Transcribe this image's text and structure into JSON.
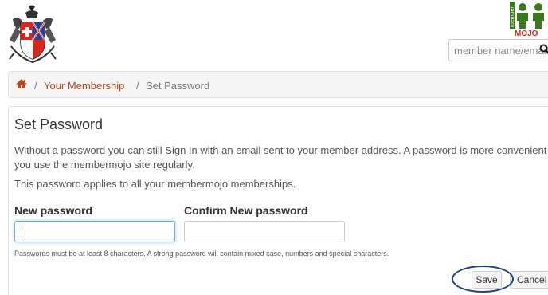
{
  "header": {
    "search": {
      "placeholder": "member name/email"
    },
    "logo_text": "member",
    "logo_brand": "MOJO"
  },
  "breadcrumb": {
    "separator": "/",
    "link": "Your Membership",
    "current": "Set Password"
  },
  "panel": {
    "title": "Set Password",
    "intro": "Without a password you can still Sign In with an email sent to your member address. A password is more convenient if you use the membermojo site regularly.",
    "applies": "This password applies to all your membermojo memberships.",
    "new_password_label": "New password",
    "confirm_password_label": "Confirm New password",
    "new_password_value": "",
    "confirm_password_value": "",
    "hint": "Passwords must be at least 8 characters. A strong password will contain mixed case, numbers and special characters.",
    "save_label": "Save",
    "cancel_label": "Cancel"
  },
  "colors": {
    "link": "#b5471b",
    "annotation": "#1c3f8f",
    "focus": "#66afe9"
  }
}
